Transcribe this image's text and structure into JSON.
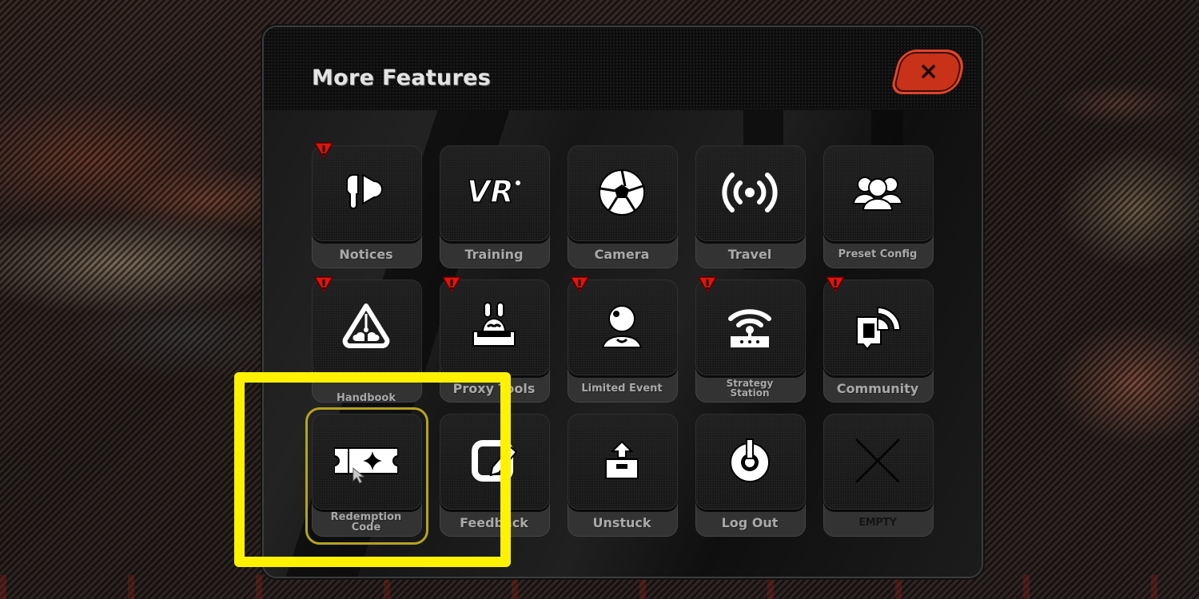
{
  "panel": {
    "title": "More Features",
    "close_button": {
      "label": "×",
      "icon": "close-icon",
      "color": "#c83218"
    }
  },
  "tiles": [
    {
      "id": "notices",
      "label": "Notices",
      "icon": "megaphone-icon",
      "alert": true,
      "selected": false
    },
    {
      "id": "training",
      "label": "Training",
      "icon": "vr-logo-icon",
      "alert": false,
      "selected": false
    },
    {
      "id": "camera",
      "label": "Camera",
      "icon": "camera-shutter-icon",
      "alert": false,
      "selected": false
    },
    {
      "id": "travel",
      "label": "Travel",
      "icon": "broadcast-signal-icon",
      "alert": false,
      "selected": false
    },
    {
      "id": "preset-config",
      "label": "Preset Config",
      "icon": "group-users-icon",
      "alert": false,
      "selected": false
    },
    {
      "id": "handbook",
      "label": "Handbook",
      "icon": "handbook-triangle-icon",
      "alert": true,
      "selected": false
    },
    {
      "id": "proxy-tools",
      "label": "Proxy Tools",
      "icon": "bunny-bot-icon",
      "alert": true,
      "selected": false
    },
    {
      "id": "limited-event",
      "label": "Limited Event",
      "icon": "webcam-avatar-icon",
      "alert": true,
      "selected": false
    },
    {
      "id": "strategy-station",
      "label": "Strategy Station",
      "icon": "router-wifi-icon",
      "alert": true,
      "selected": false
    },
    {
      "id": "community",
      "label": "Community",
      "icon": "chat-signal-icon",
      "alert": true,
      "selected": false
    },
    {
      "id": "redemption-code",
      "label": "Redemption Code",
      "icon": "ticket-star-icon",
      "alert": false,
      "selected": true
    },
    {
      "id": "feedback",
      "label": "Feedback",
      "icon": "edit-note-icon",
      "alert": false,
      "selected": false
    },
    {
      "id": "unstuck",
      "label": "Unstuck",
      "icon": "box-arrow-up-icon",
      "alert": false,
      "selected": false
    },
    {
      "id": "log-out",
      "label": "Log Out",
      "icon": "power-icon",
      "alert": false,
      "selected": false
    },
    {
      "id": "empty",
      "label": "EMPTY",
      "icon": "x-mark-icon",
      "alert": false,
      "selected": false
    }
  ],
  "alert_badge": {
    "symbol": "!",
    "color": "#e0140e"
  },
  "annotation": {
    "highlight_color": "#fff200",
    "target": "Redemption Code"
  }
}
